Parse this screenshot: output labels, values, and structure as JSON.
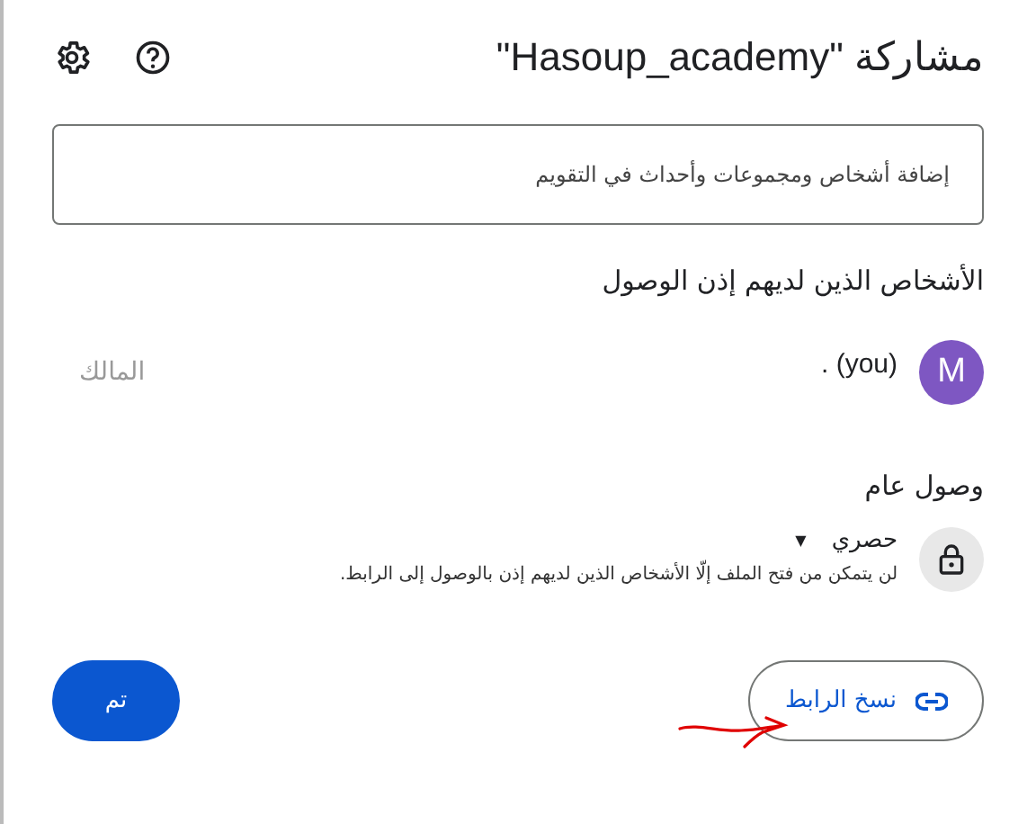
{
  "dialog": {
    "title": "مشاركة \"Hasoup_academy\""
  },
  "add_field": {
    "placeholder": "إضافة أشخاص ومجموعات وأحداث في التقويم"
  },
  "people_section": {
    "heading": "الأشخاص الذين لديهم إذن الوصول",
    "people": [
      {
        "avatar_letter": "M",
        "color": "#7e57c2",
        "name": ". (you)",
        "role": "المالك"
      }
    ]
  },
  "general_access": {
    "heading": "وصول عام",
    "option": "حصري",
    "caret": "▼",
    "description": "لن يتمكن من فتح الملف إلّا الأشخاص الذين لديهم إذن بالوصول إلى الرابط."
  },
  "buttons": {
    "copy_link": "نسخ الرابط",
    "done": "تم"
  }
}
